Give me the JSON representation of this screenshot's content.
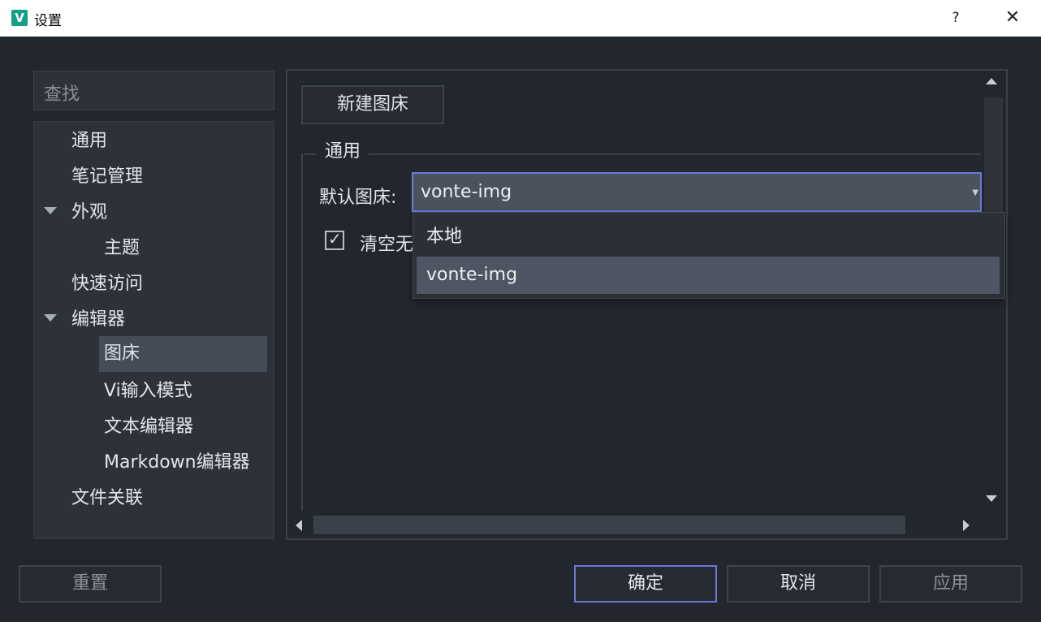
{
  "window": {
    "title": "设置",
    "app_icon_letter": "V",
    "help": "?",
    "close": "✕"
  },
  "search": {
    "placeholder": "查找"
  },
  "nav": {
    "items": [
      {
        "label": "通用"
      },
      {
        "label": "笔记管理"
      },
      {
        "label": "外观"
      },
      {
        "label": "主题"
      },
      {
        "label": "快速访问"
      },
      {
        "label": "编辑器"
      },
      {
        "label": "图床"
      },
      {
        "label": "Vi输入模式"
      },
      {
        "label": "文本编辑器"
      },
      {
        "label": "Markdown编辑器"
      },
      {
        "label": "文件关联"
      }
    ],
    "selected": "图床"
  },
  "content": {
    "new_button": "新建图床",
    "group_title": "通用",
    "default_label": "默认图床:",
    "default_value": "vonte-img",
    "checkbox_label": "清空无",
    "checkbox_checked": true,
    "dropdown_options": [
      "本地",
      "vonte-img"
    ],
    "dropdown_highlighted": "vonte-img"
  },
  "footer": {
    "reset": "重置",
    "ok": "确定",
    "cancel": "取消",
    "apply": "应用"
  },
  "colors": {
    "accent_border": "#6d77d8",
    "app_icon": "#14a085",
    "background": "#22262d"
  }
}
